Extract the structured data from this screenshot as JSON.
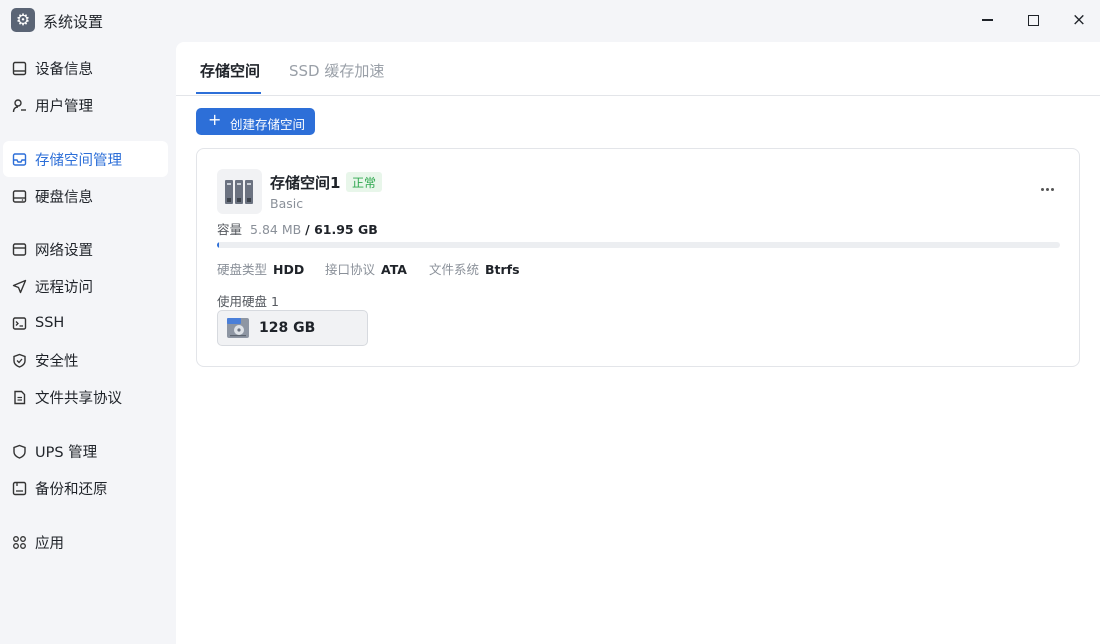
{
  "window": {
    "title": "系统设置",
    "icon": "gear-icon",
    "controls": [
      "minimize-icon",
      "maximize-icon",
      "close-icon"
    ],
    "close_glyph": "×"
  },
  "sidebar": {
    "items": [
      {
        "label": "设备信息",
        "icon": "device-icon"
      },
      {
        "label": "用户管理",
        "icon": "user-icon"
      },
      {
        "label": "存储空间管理",
        "icon": "storage-icon",
        "active": true
      },
      {
        "label": "硬盘信息",
        "icon": "disk-icon"
      },
      {
        "label": "网络设置",
        "icon": "network-icon"
      },
      {
        "label": "远程访问",
        "icon": "send-icon"
      },
      {
        "label": "SSH",
        "icon": "terminal-icon"
      },
      {
        "label": "安全性",
        "icon": "shield-icon"
      },
      {
        "label": "文件共享协议",
        "icon": "document-icon"
      },
      {
        "label": "UPS 管理",
        "icon": "ups-shield-icon"
      },
      {
        "label": "备份和还原",
        "icon": "backup-icon"
      },
      {
        "label": "应用",
        "icon": "apps-icon"
      }
    ]
  },
  "tabs": [
    {
      "label": "存储空间",
      "active": true
    },
    {
      "label": "SSD 缓存加速",
      "active": false
    }
  ],
  "toolbar": {
    "create_label": "创建存储空间",
    "create_glyph": "+"
  },
  "pool": {
    "name": "存储空间1",
    "status": "正常",
    "type": "Basic",
    "capacity_label": "容量",
    "used": "5.84 MB",
    "total": "/ 61.95 GB",
    "usage_fraction": 0.0001,
    "props": [
      {
        "key": "硬盘类型",
        "value": "HDD"
      },
      {
        "key": "接口协议",
        "value": "ATA"
      },
      {
        "key": "文件系统",
        "value": "Btrfs"
      }
    ],
    "disks_label": "使用硬盘 1",
    "disks": [
      {
        "size": "128 GB",
        "icon": "hard-drive-icon"
      }
    ]
  },
  "colors": {
    "accent": "#2d6fd8",
    "status_ok": "#2fa84f",
    "status_ok_bg": "#e8f6ea"
  }
}
